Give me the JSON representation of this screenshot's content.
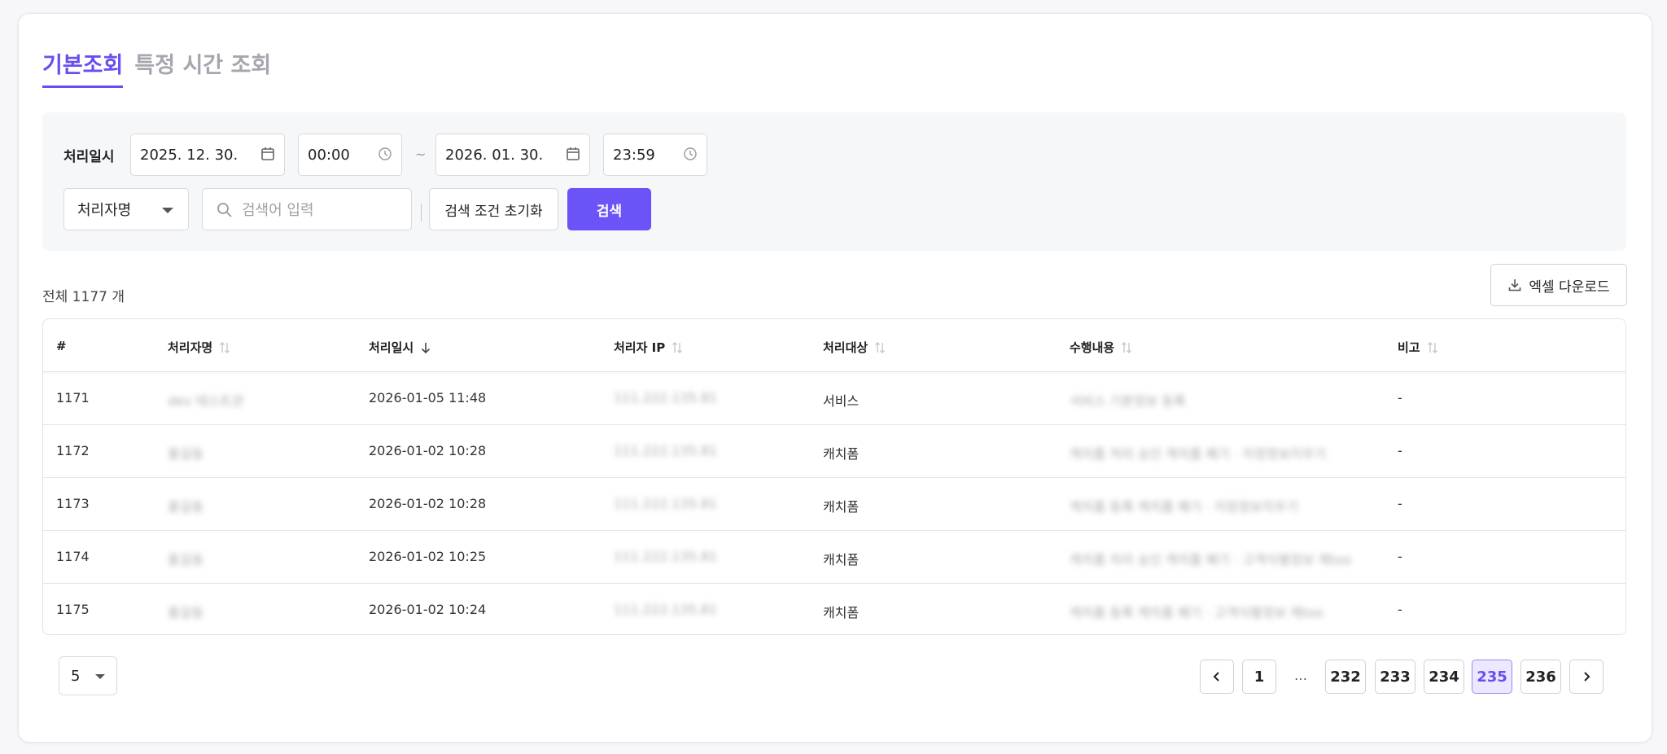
{
  "tabs": [
    {
      "label": "기본조회",
      "active": true
    },
    {
      "label": "특정 시간 조회",
      "active": false
    }
  ],
  "filter": {
    "date_label": "처리일시",
    "start_date": "2025. 12. 30.",
    "start_time": "00:00",
    "separator": "~",
    "end_date": "2026. 01. 30.",
    "end_time": "23:59",
    "field_select": "처리자명",
    "search_placeholder": "검색어 입력",
    "reset_label": "검색 조건 초기화",
    "search_label": "검색"
  },
  "summary": {
    "total_label": "전체 1177 개",
    "excel_label": "엑셀 다운로드"
  },
  "table": {
    "columns": [
      "#",
      "처리자명",
      "처리일시",
      "처리자 IP",
      "처리대상",
      "수행내용",
      "비고"
    ],
    "rows": [
      {
        "no": "1171",
        "name": "dev 테스트관",
        "time": "2026-01-05 11:48",
        "ip": "111.222.135.81",
        "target": "서비스",
        "action": "서비스 기본정보 등록",
        "note": "-"
      },
      {
        "no": "1172",
        "name": "홍길동",
        "time": "2026-01-02 10:28",
        "ip": "111.222.135.81",
        "target": "캐치폼",
        "action": "캐치폼 처리 승인 캐치폼 폐기 · 지정정보지우기",
        "note": "-"
      },
      {
        "no": "1173",
        "name": "홍길동",
        "time": "2026-01-02 10:28",
        "ip": "111.222.135.81",
        "target": "캐치폼",
        "action": "캐치폼 등록 캐치폼 폐기 · 지정정보지우기",
        "note": "-"
      },
      {
        "no": "1174",
        "name": "홍길동",
        "time": "2026-01-02 10:25",
        "ip": "111.222.135.81",
        "target": "캐치폼",
        "action": "캐치폼 처리 승인 캐치폼 폐기 · 고객식별정보 제too",
        "note": "-"
      },
      {
        "no": "1175",
        "name": "홍길동",
        "time": "2026-01-02 10:24",
        "ip": "111.222.135.81",
        "target": "캐치폼",
        "action": "캐치폼 등록 캐치폼 폐기 · 고객식별정보 제too",
        "note": "-"
      }
    ]
  },
  "pagination": {
    "page_size": "5",
    "pages": [
      "1",
      "…",
      "232",
      "233",
      "234",
      "235",
      "236"
    ],
    "current": "235"
  },
  "colors": {
    "accent": "#6a53f7",
    "accent_text": "#6a4df0"
  }
}
